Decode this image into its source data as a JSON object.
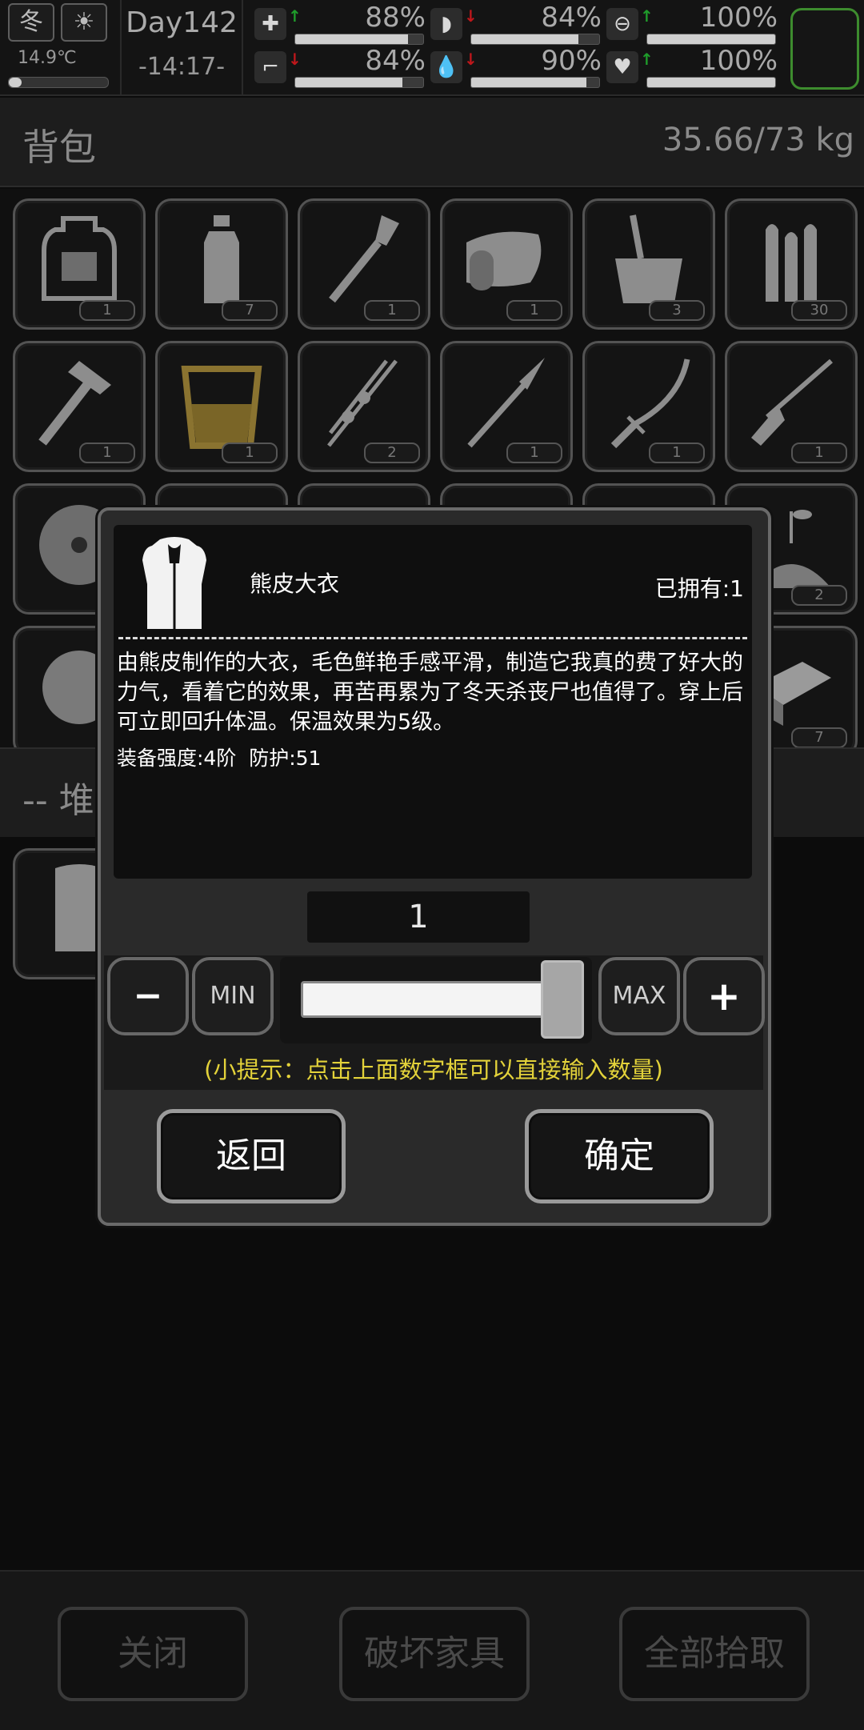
{
  "status": {
    "season": "冬",
    "temperature": "14.9℃",
    "day": "Day142",
    "time": "-14:17-",
    "stats": [
      {
        "icon": "medkit-icon",
        "arrow": "up",
        "value": "88%",
        "level": 0.88
      },
      {
        "icon": "stomach-icon",
        "arrow": "down",
        "value": "84%",
        "level": 0.84
      },
      {
        "icon": "pill-icon",
        "arrow": "up",
        "value": "100%",
        "level": 1.0
      },
      {
        "icon": "foot-icon",
        "arrow": "down",
        "value": "84%",
        "level": 0.84
      },
      {
        "icon": "water-drop-icon",
        "arrow": "down",
        "value": "90%",
        "level": 0.9
      },
      {
        "icon": "heart-icon",
        "arrow": "up",
        "value": "100%",
        "level": 1.0
      }
    ]
  },
  "bag": {
    "title": "背包",
    "weight": "35.66/73 kg",
    "items": [
      {
        "name": "backpack-icon",
        "count": "1"
      },
      {
        "name": "bottle-icon",
        "count": "7"
      },
      {
        "name": "shovel-icon",
        "count": "1"
      },
      {
        "name": "bandage-icon",
        "count": "1"
      },
      {
        "name": "bucket-icon",
        "count": "3"
      },
      {
        "name": "bullets-icon",
        "count": "30"
      },
      {
        "name": "hammer-icon",
        "count": "1"
      },
      {
        "name": "glass-icon",
        "count": "1"
      },
      {
        "name": "bone-spear-icon",
        "count": "2"
      },
      {
        "name": "spear-icon",
        "count": "1"
      },
      {
        "name": "katana-icon",
        "count": "1"
      },
      {
        "name": "rifle-icon",
        "count": "1"
      }
    ],
    "row3_right_count": "2",
    "row4_right_count": "7"
  },
  "pile": {
    "title": "-- 堆"
  },
  "modal": {
    "item_name": "熊皮大衣",
    "owned": "已拥有:1",
    "desc": "由熊皮制作的大衣，毛色鲜艳手感平滑，制造它我真的费了好大的力气，看着它的效果，再苦再累为了冬天杀丧尸也值得了。穿上后可立即回升体温。保温效果为5级。",
    "stats_line": "装备强度:4阶  防护:51",
    "quantity": "1",
    "slider_level": 1.0,
    "min_label": "MIN",
    "max_label": "MAX",
    "minus_label": "−",
    "plus_label": "+",
    "tip": "(小提示：点击上面数字框可以直接输入数量)",
    "back_label": "返回",
    "confirm_label": "确定"
  },
  "bottom": {
    "close_label": "关闭",
    "destroy_label": "破坏家具",
    "pickup_all_label": "全部拾取"
  },
  "colors": {
    "up_arrow": "#1f9d2b",
    "down_arrow": "#c0171b",
    "tip": "#e3d23a",
    "accent_frame": "#3d8c2e"
  }
}
